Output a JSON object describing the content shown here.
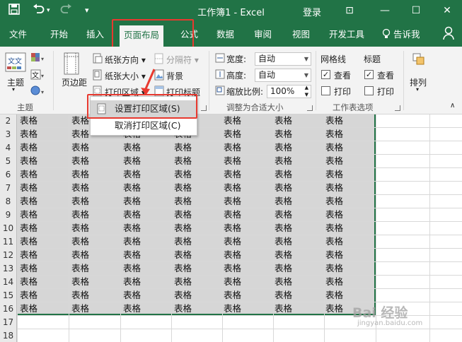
{
  "window": {
    "title": "工作簿1 - Excel",
    "login": "登录",
    "controls": {
      "ribbon_options": "⊡",
      "minimize": "—",
      "maximize": "☐",
      "close": "✕"
    }
  },
  "quick_access": {
    "save_icon": "save-icon",
    "undo_icon": "undo-icon",
    "redo_icon": "redo-icon",
    "customize": "▾"
  },
  "tabs": [
    {
      "label": "文件"
    },
    {
      "label": "开始"
    },
    {
      "label": "插入"
    },
    {
      "label": "页面布局",
      "active": true
    },
    {
      "label": "公式"
    },
    {
      "label": "数据"
    },
    {
      "label": "审阅"
    },
    {
      "label": "视图"
    },
    {
      "label": "开发工具"
    },
    {
      "label": "告诉我"
    }
  ],
  "ribbon": {
    "themes": {
      "button": "主题",
      "group": "主题"
    },
    "page_setup": {
      "margins": "页边距",
      "orientation": "纸张方向",
      "size": "纸张大小",
      "print_area": "打印区域",
      "breaks": "分隔符",
      "background": "背景",
      "print_titles": "打印标题"
    },
    "scale": {
      "width_label": "宽度:",
      "width_value": "自动",
      "height_label": "高度:",
      "height_value": "自动",
      "scale_label": "缩放比例:",
      "scale_value": "100%",
      "group": "调整为合适大小"
    },
    "sheet_options": {
      "gridlines": "网格线",
      "headings": "标题",
      "view": "查看",
      "print": "打印",
      "group": "工作表选项"
    },
    "arrange": {
      "label": "排列"
    }
  },
  "dropdown": {
    "items": [
      "设置打印区域(S)",
      "取消打印区域(C)"
    ]
  },
  "sheet": {
    "row_numbers": [
      "2",
      "3",
      "4",
      "5",
      "6",
      "7",
      "8",
      "9",
      "10",
      "11",
      "12",
      "13",
      "14",
      "15",
      "16",
      "17",
      "18"
    ],
    "cell_text": "表格"
  },
  "watermark": {
    "brand": "Bai 经验",
    "url": "jingyan.baidu.com"
  },
  "colors": {
    "excel_green": "#217346",
    "highlight_red": "#e8392f",
    "selection_gray": "#d6d6d6"
  }
}
